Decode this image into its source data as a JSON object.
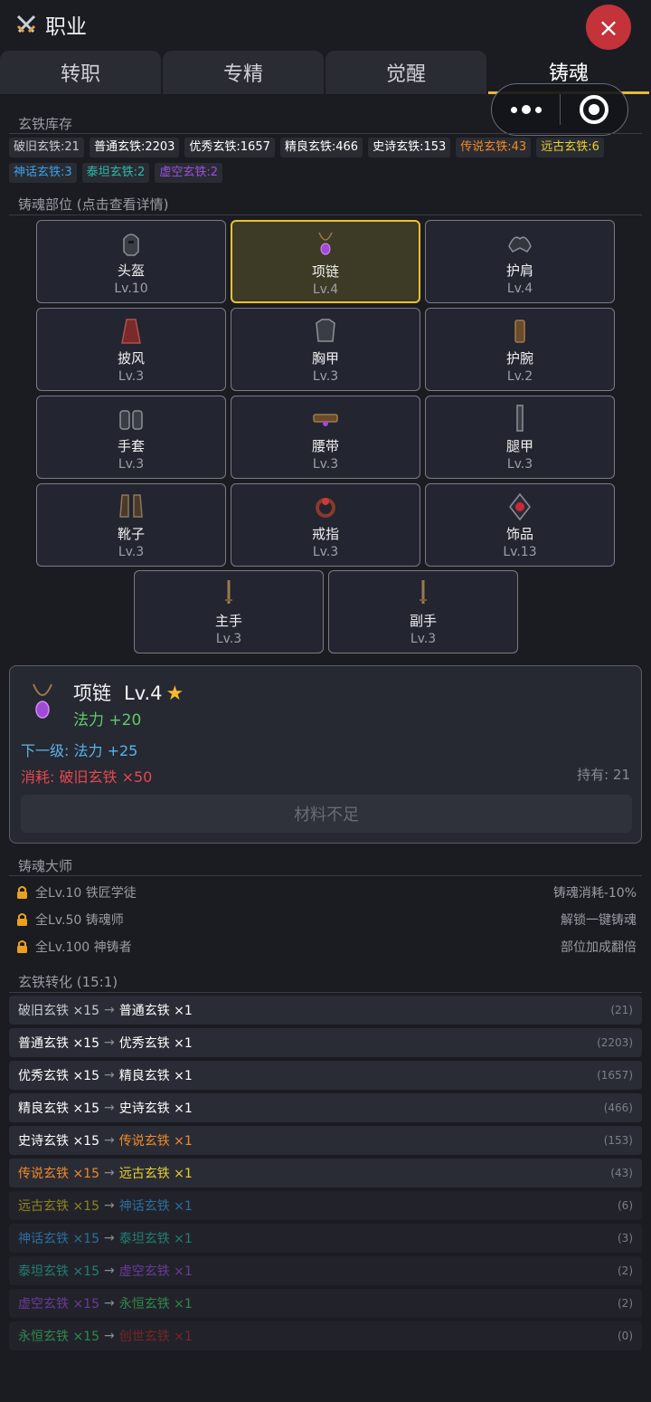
{
  "header": {
    "title": "职业",
    "close_icon": "×"
  },
  "tabs": [
    {
      "label": "转职",
      "active": false
    },
    {
      "label": "专精",
      "active": false
    },
    {
      "label": "觉醒",
      "active": false
    },
    {
      "label": "铸魂",
      "active": true
    }
  ],
  "inventory": {
    "label": "玄铁库存",
    "items": [
      {
        "text": "破旧玄铁:21",
        "color": "#c9cbd0"
      },
      {
        "text": "普通玄铁:2203",
        "color": "#ffffff"
      },
      {
        "text": "优秀玄铁:1657",
        "color": "#ffffff"
      },
      {
        "text": "精良玄铁:466",
        "color": "#ffffff"
      },
      {
        "text": "史诗玄铁:153",
        "color": "#ffffff"
      },
      {
        "text": "传说玄铁:43",
        "color": "#f08a2a"
      },
      {
        "text": "远古玄铁:6",
        "color": "#e8d02e"
      },
      {
        "text": "神话玄铁:3",
        "color": "#3aa0e8"
      },
      {
        "text": "泰坦玄铁:2",
        "color": "#2eb8a8"
      },
      {
        "text": "虚空玄铁:2",
        "color": "#9b4ee0"
      }
    ]
  },
  "slots_label": "铸魂部位 (点击查看详情)",
  "slots": [
    {
      "name": "头盔",
      "level": "Lv.10",
      "icon": "helmet-icon",
      "selected": false
    },
    {
      "name": "项链",
      "level": "Lv.4",
      "icon": "necklace-icon",
      "selected": true
    },
    {
      "name": "护肩",
      "level": "Lv.4",
      "icon": "pauldron-icon",
      "selected": false
    },
    {
      "name": "披风",
      "level": "Lv.3",
      "icon": "cloak-icon",
      "selected": false
    },
    {
      "name": "胸甲",
      "level": "Lv.3",
      "icon": "chest-armor-icon",
      "selected": false
    },
    {
      "name": "护腕",
      "level": "Lv.2",
      "icon": "bracer-icon",
      "selected": false
    },
    {
      "name": "手套",
      "level": "Lv.3",
      "icon": "gloves-icon",
      "selected": false
    },
    {
      "name": "腰带",
      "level": "Lv.3",
      "icon": "belt-icon",
      "selected": false
    },
    {
      "name": "腿甲",
      "level": "Lv.3",
      "icon": "leg-armor-icon",
      "selected": false
    },
    {
      "name": "靴子",
      "level": "Lv.3",
      "icon": "boots-icon",
      "selected": false
    },
    {
      "name": "戒指",
      "level": "Lv.3",
      "icon": "ring-icon",
      "selected": false
    },
    {
      "name": "饰品",
      "level": "Lv.13",
      "icon": "trinket-icon",
      "selected": false
    },
    {
      "name": "主手",
      "level": "Lv.3",
      "icon": "main-hand-icon",
      "selected": false
    },
    {
      "name": "副手",
      "level": "Lv.3",
      "icon": "off-hand-icon",
      "selected": false
    }
  ],
  "detail": {
    "name": "项链",
    "level": "Lv.4",
    "star": "★",
    "stat": "法力 +20",
    "next": "下一级: 法力 +25",
    "cost": "消耗: 破旧玄铁 ×50",
    "own": "持有: 21",
    "button": "材料不足"
  },
  "master": {
    "label": "铸魂大师",
    "rows": [
      {
        "left": "全Lv.10 铁匠学徒",
        "right": "铸魂消耗-10%"
      },
      {
        "left": "全Lv.50 铸魂师",
        "right": "解锁一键铸魂"
      },
      {
        "left": "全Lv.100 神铸者",
        "right": "部位加成翻倍"
      }
    ]
  },
  "conversion": {
    "label": "玄铁转化 (15:1)",
    "arrow": "→",
    "rows": [
      {
        "from": "破旧玄铁 ×15",
        "to": "普通玄铁 ×1",
        "have": "(21)",
        "from_color": "#c9cbd0",
        "to_color": "#ffffff",
        "dim": false
      },
      {
        "from": "普通玄铁 ×15",
        "to": "优秀玄铁 ×1",
        "have": "(2203)",
        "from_color": "#ffffff",
        "to_color": "#ffffff",
        "dim": false
      },
      {
        "from": "优秀玄铁 ×15",
        "to": "精良玄铁 ×1",
        "have": "(1657)",
        "from_color": "#ffffff",
        "to_color": "#ffffff",
        "dim": false
      },
      {
        "from": "精良玄铁 ×15",
        "to": "史诗玄铁 ×1",
        "have": "(466)",
        "from_color": "#ffffff",
        "to_color": "#ffffff",
        "dim": false
      },
      {
        "from": "史诗玄铁 ×15",
        "to": "传说玄铁 ×1",
        "have": "(153)",
        "from_color": "#ffffff",
        "to_color": "#f08a2a",
        "dim": false
      },
      {
        "from": "传说玄铁 ×15",
        "to": "远古玄铁 ×1",
        "have": "(43)",
        "from_color": "#f08a2a",
        "to_color": "#e8d02e",
        "dim": false
      },
      {
        "from": "远古玄铁 ×15",
        "to": "神话玄铁 ×1",
        "have": "(6)",
        "from_color": "#8f8420",
        "to_color": "#2a6fa0",
        "dim": true
      },
      {
        "from": "神话玄铁 ×15",
        "to": "泰坦玄铁 ×1",
        "have": "(3)",
        "from_color": "#2a6fa0",
        "to_color": "#227e74",
        "dim": true
      },
      {
        "from": "泰坦玄铁 ×15",
        "to": "虚空玄铁 ×1",
        "have": "(2)",
        "from_color": "#227e74",
        "to_color": "#6a3a9a",
        "dim": true
      },
      {
        "from": "虚空玄铁 ×15",
        "to": "永恒玄铁 ×1",
        "have": "(2)",
        "from_color": "#6a3a9a",
        "to_color": "#2e8a4a",
        "dim": true
      },
      {
        "from": "永恒玄铁 ×15",
        "to": "创世玄铁 ×1",
        "have": "(0)",
        "from_color": "#2e8a4a",
        "to_color": "#7a2424",
        "dim": true
      }
    ]
  }
}
